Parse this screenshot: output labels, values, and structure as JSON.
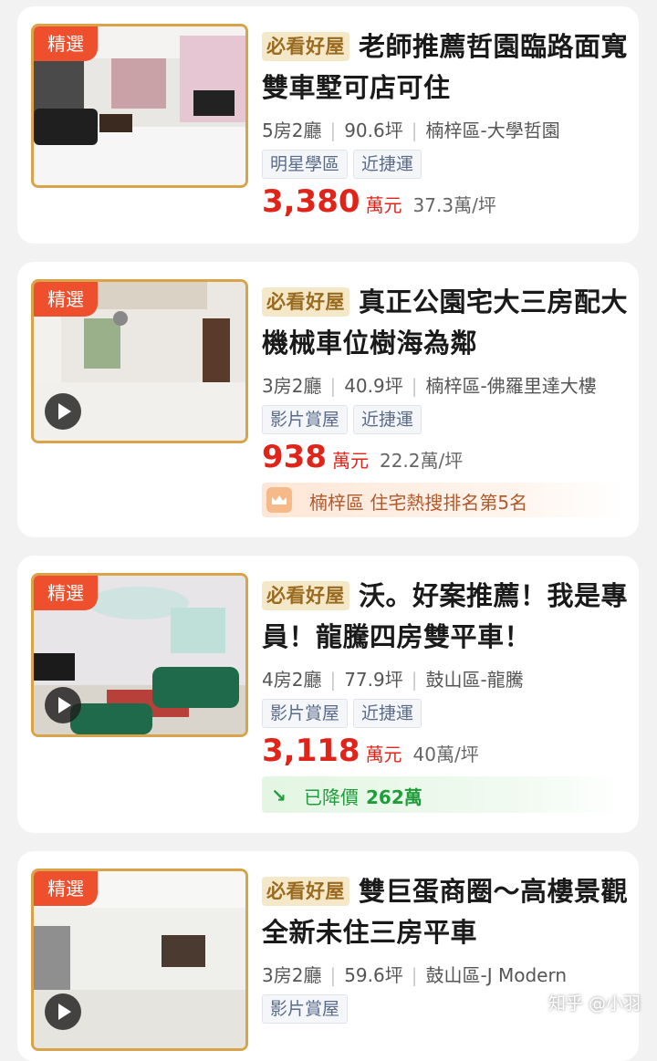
{
  "listings": [
    {
      "badge": "精選",
      "must_see": "必看好屋",
      "title": "老師推薦哲園臨路面寬雙車墅可店可住",
      "rooms": "5房2廳",
      "size": "90.6坪",
      "location": "楠梓區-大學哲園",
      "features": [
        "明星學區",
        "近捷運"
      ],
      "price": "3,380",
      "price_unit": "萬元",
      "per_ping": "37.3萬/坪",
      "has_video": false
    },
    {
      "badge": "精選",
      "must_see": "必看好屋",
      "title": "真正公園宅大三房配大機械車位樹海為鄰",
      "rooms": "3房2廳",
      "size": "40.9坪",
      "location": "楠梓區-佛羅里達大樓",
      "features": [
        "影片賞屋",
        "近捷運"
      ],
      "price": "938",
      "price_unit": "萬元",
      "per_ping": "22.2萬/坪",
      "hot_rank": "楠梓區 住宅熱搜排名第5名",
      "has_video": true
    },
    {
      "badge": "精選",
      "must_see": "必看好屋",
      "title": "沃。好案推薦！我是專員！龍騰四房雙平車！",
      "rooms": "4房2廳",
      "size": "77.9坪",
      "location": "鼓山區-龍騰",
      "features": [
        "影片賞屋",
        "近捷運"
      ],
      "price": "3,118",
      "price_unit": "萬元",
      "per_ping": "40萬/坪",
      "price_drop_label": "已降價",
      "price_drop_amount": "262萬",
      "has_video": true
    },
    {
      "badge": "精選",
      "must_see": "必看好屋",
      "title": "雙巨蛋商圈～高樓景觀全新未住三房平車",
      "rooms": "3房2廳",
      "size": "59.6坪",
      "location": "鼓山區-J Modern",
      "features": [
        "影片賞屋"
      ],
      "has_video": true
    }
  ],
  "watermark": "知乎 @小羽",
  "colors": {
    "price_red": "#e0241a",
    "badge_orange": "#ee4f2d",
    "drop_green": "#1f9d3a",
    "frame_gold": "#d9a34a"
  }
}
